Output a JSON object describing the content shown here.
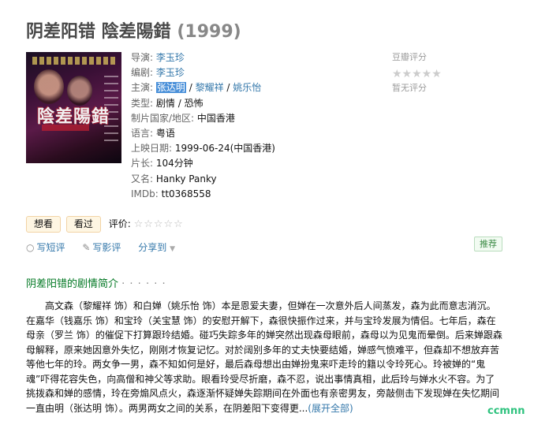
{
  "title": {
    "main": "阴差阳错 陰差陽錯",
    "year": "(1999)"
  },
  "poster": {
    "text": "陰差陽錯"
  },
  "info": {
    "director_label": "导演:",
    "director": "李玉珍",
    "writer_label": "编剧:",
    "writer": "李玉珍",
    "cast_label": "主演:",
    "cast": [
      "张达明",
      "黎耀祥",
      "姚乐怡"
    ],
    "cast_sep": " / ",
    "genre_label": "类型:",
    "genre": [
      "剧情",
      "恐怖"
    ],
    "region_label": "制片国家/地区:",
    "region": "中国香港",
    "language_label": "语言:",
    "language": "粤语",
    "release_label": "上映日期:",
    "release": "1999-06-24(中国香港)",
    "runtime_label": "片长:",
    "runtime": "104分钟",
    "aka_label": "又名:",
    "aka": "Hanky Panky",
    "imdb_label": "IMDb:",
    "imdb": "tt0368558"
  },
  "rating": {
    "label": "豆瓣评分",
    "stars": "★★★★★",
    "none": "暂无评分"
  },
  "buttons": {
    "want": "想看",
    "seen": "看过",
    "rate_label": "评价:",
    "rate_stars": "☆☆☆☆☆"
  },
  "actions": {
    "short_review": "写短评",
    "review": "写影评",
    "share": "分享到",
    "share_caret": "▼"
  },
  "recommend": "推荐",
  "intro": {
    "title": "阴差阳错的剧情简介",
    "dots": "· · · · · ·",
    "text": "高文森（黎耀祥 饰）和白婵（姚乐怡 饰）本是恩爱夫妻，但婵在一次意外后人间蒸发，森为此而意志消沉。在嘉华（钱嘉乐 饰）和宝玲（关宝慧 饰）的安慰开解下，森很快振作过来，并与宝玲发展为情侣。七年后，森在母亲（罗兰 饰）的催促下打算跟玲结婚。碰巧失踪多年的婵突然出现森母眼前，森母以为见鬼而晕倒。后来婵跟森母解释，原来她因意外失忆，刚刚才恢复记忆。对於阔别多年的丈夫快要结婚，婵感气愤难平，但森却不想放弃苦等他七年的玲。两女争一男，森不知如何是好，最后森母想出由婵扮鬼来吓走玲的籍以令玲死心。玲被婵的“鬼魂”吓得花容失色，向高僧和神父等求助。眼看玲受尽折磨，森不忍，说出事情真相，此后玲与婵水火不容。为了挑拨森和婵的感情，玲在旁煽风点火，森逐渐怀疑婵失踪期间在外面也有亲密男友，旁敲侧击下发现婵在失忆期间一直由明（张达明 饰）。两男两女之间的关系，在阴差阳下变得更...",
    "expand": "(展开全部)"
  },
  "watermark": "ccmnn"
}
